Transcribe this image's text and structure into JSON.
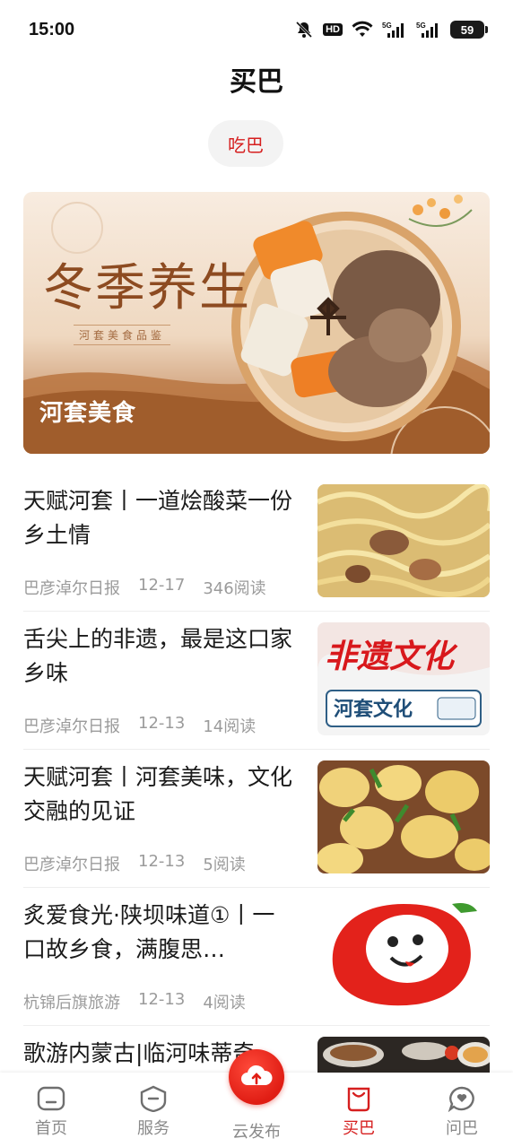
{
  "status_bar": {
    "time": "15:00",
    "hd_label": "HD",
    "network": "5G",
    "battery": "59"
  },
  "header": {
    "title": "买巴"
  },
  "tabs": [
    {
      "label": "吃巴",
      "active": true
    }
  ],
  "banner": {
    "art_title": "冬季养生",
    "art_subtitle": "河套美食品鉴",
    "caption": "河套美食"
  },
  "articles": [
    {
      "title": "天赋河套丨一道烩酸菜一份乡土情",
      "source": "巴彦淖尔日报",
      "date": "12-17",
      "reads": "346阅读",
      "thumb": "braised-sauerkraut-photo"
    },
    {
      "title": "舌尖上的非遗，最是这口家乡味",
      "source": "巴彦淖尔日报",
      "date": "12-13",
      "reads": "14阅读",
      "thumb": "hetao-culture-graphic",
      "thumb_text_top": "非遗文化",
      "thumb_text_bottom": "河套文化"
    },
    {
      "title": "天赋河套丨河套美味，文化交融的见证",
      "source": "巴彦淖尔日报",
      "date": "12-13",
      "reads": "5阅读",
      "thumb": "potato-dish-photo"
    },
    {
      "title": "炙爱食光·陕坝味道①丨一口故乡食，满腹思…",
      "source": "杭锦后旗旅游",
      "date": "12-13",
      "reads": "4阅读",
      "thumb": "red-mascot-logo"
    },
    {
      "title": "歌游内蒙古|临河味蒂奇",
      "source": "",
      "date": "",
      "reads": "",
      "thumb": "food-table-photo"
    }
  ],
  "bottom_nav": [
    {
      "label": "首页",
      "icon": "home-icon"
    },
    {
      "label": "服务",
      "icon": "service-icon"
    },
    {
      "label": "云发布",
      "icon": "cloud-upload-icon"
    },
    {
      "label": "买巴",
      "icon": "shopping-bag-icon",
      "active": true
    },
    {
      "label": "问巴",
      "icon": "chat-heart-icon"
    }
  ],
  "colors": {
    "accent": "#d61f1f",
    "text_primary": "#1a1a1a",
    "text_meta": "#9b9b9b",
    "nav_inactive": "#8a8a8a"
  }
}
